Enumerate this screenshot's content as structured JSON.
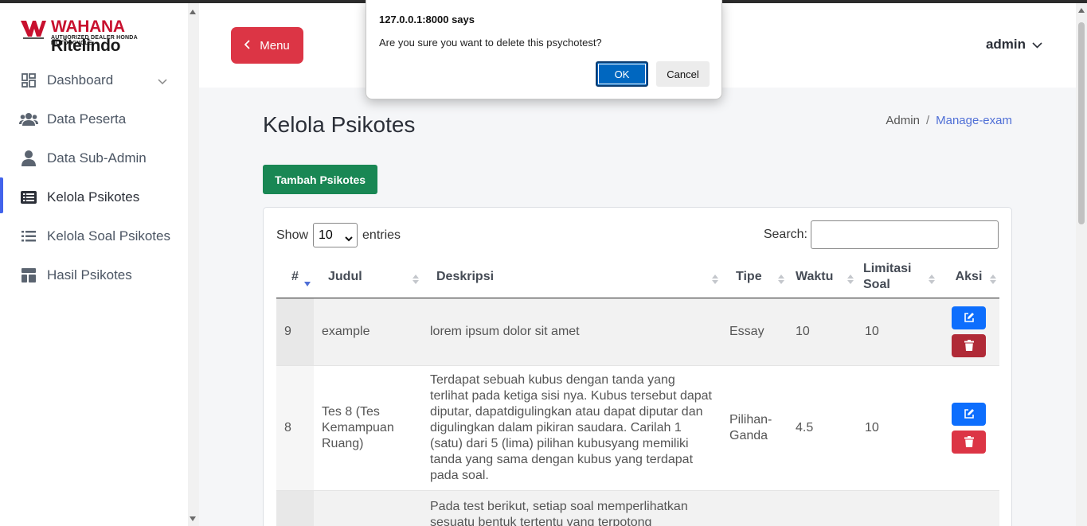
{
  "brand": {
    "name_accent": "WAHANA",
    "name": "Ritelindo",
    "tagline": "AUTHORIZED DEALER HONDA MOTORCYCLE"
  },
  "sidebar": {
    "items": [
      {
        "label": "Dashboard",
        "icon": "dashboard-icon",
        "active": false,
        "has_chevron": true
      },
      {
        "label": "Data Peserta",
        "icon": "users-icon",
        "active": false
      },
      {
        "label": "Data Sub-Admin",
        "icon": "user-icon",
        "active": false
      },
      {
        "label": "Kelola Psikotes",
        "icon": "list-alt-icon",
        "active": true
      },
      {
        "label": "Kelola Soal Psikotes",
        "icon": "list-icon",
        "active": false
      },
      {
        "label": "Hasil Psikotes",
        "icon": "layout-icon",
        "active": false
      }
    ]
  },
  "header": {
    "menu_label": "Menu",
    "user": "admin"
  },
  "page": {
    "title": "Kelola Psikotes",
    "breadcrumb": {
      "root": "Admin",
      "separator": "/",
      "current": "Manage-exam"
    },
    "add_button": "Tambah Psikotes"
  },
  "table_controls": {
    "show_label": "Show",
    "entries_value": "10",
    "entries_label": "entries",
    "search_label": "Search:",
    "search_value": ""
  },
  "table": {
    "headers": [
      "#",
      "Judul",
      "Deskripsi",
      "Tipe",
      "Waktu",
      "Limitasi Soal",
      "Aksi"
    ],
    "rows": [
      {
        "id": "9",
        "judul": "example",
        "deskripsi": "lorem ipsum dolor sit amet",
        "tipe": "Essay",
        "waktu": "10",
        "limitasi": "10"
      },
      {
        "id": "8",
        "judul": "Tes 8 (Tes Kemampuan Ruang)",
        "deskripsi": "Terdapat sebuah kubus dengan tanda yang terlihat pada ketiga sisi nya. Kubus tersebut dapat diputar, dapatdigulingkan atau dapat diputar dan digulingkan dalam pikiran saudara. Carilah 1 (satu) dari 5 (lima) pilihan kubusyang memiliki tanda yang sama dengan kubus yang terdapat pada soal.",
        "tipe": "Pilihan-Ganda",
        "waktu": "4.5",
        "limitasi": "10"
      },
      {
        "id": "",
        "judul": "",
        "deskripsi": "Pada test berikut, setiap soal memperlihatkan sesuatu bentuk tertentu yang terpotong",
        "tipe": "",
        "waktu": "",
        "limitasi": ""
      }
    ]
  },
  "dialog": {
    "origin": "127.0.0.1:8000 says",
    "message": "Are you sure you want to delete this psychotest?",
    "ok": "OK",
    "cancel": "Cancel"
  },
  "colors": {
    "danger": "#dc3545",
    "success": "#198754",
    "primary": "#0d6efd",
    "active_indicator": "#4263eb"
  }
}
